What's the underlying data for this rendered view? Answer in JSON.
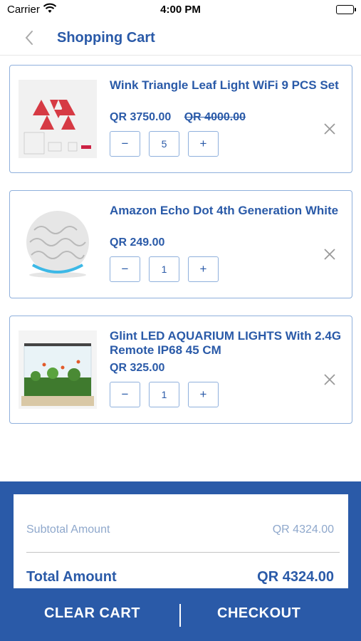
{
  "status_bar": {
    "carrier": "Carrier",
    "time": "4:00 PM"
  },
  "header": {
    "title": "Shopping Cart",
    "back_icon": "chevron-left-icon"
  },
  "cart_items": [
    {
      "name": "Wink Triangle Leaf Light WiFi 9 PCS Set",
      "price": "QR 3750.00",
      "old_price": "QR 4000.00",
      "quantity": "5",
      "minus": "−",
      "plus": "+"
    },
    {
      "name": "Amazon Echo Dot 4th Generation White",
      "price": "QR  249.00",
      "quantity": "1",
      "minus": "−",
      "plus": "+"
    },
    {
      "name": "Glint LED AQUARIUM LIGHTS With 2.4G Remote IP68 45 CM",
      "price": "QR  325.00",
      "quantity": "1",
      "minus": "−",
      "plus": "+"
    }
  ],
  "summary": {
    "subtotal_label": "Subtotal Amount",
    "subtotal_value": "QR 4324.00",
    "total_label": "Total Amount",
    "total_value": "QR 4324.00"
  },
  "footer": {
    "clear_label": "CLEAR CART",
    "checkout_label": "CHECKOUT"
  },
  "colors": {
    "brand": "#2a5aa8",
    "border": "#8fb0dc",
    "muted": "#8fa8cc"
  }
}
